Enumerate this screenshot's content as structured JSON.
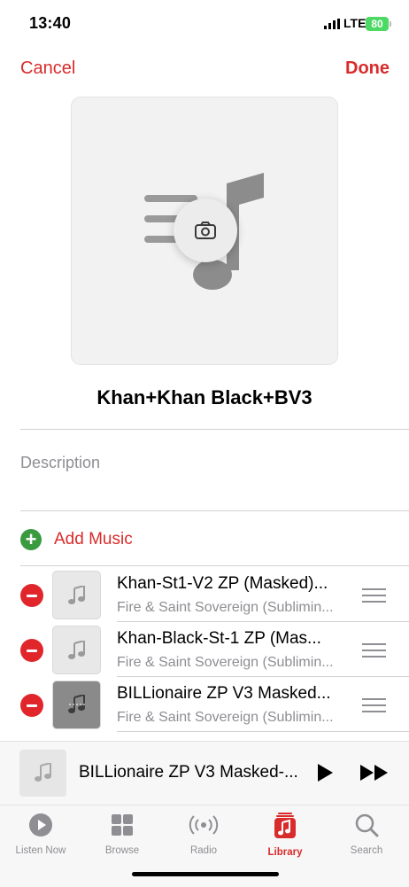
{
  "status_bar": {
    "time": "13:40",
    "network": "LTE",
    "battery": "80"
  },
  "nav": {
    "cancel_label": "Cancel",
    "done_label": "Done"
  },
  "playlist": {
    "title": "Khan+Khan Black+BV3",
    "description_placeholder": "Description"
  },
  "add_music_label": "Add Music",
  "tracks": [
    {
      "title": "Khan-St1-V2 ZP (Masked)...",
      "artist": "Fire & Saint Sovereign (Sublimin..."
    },
    {
      "title": "Khan-Black-St-1 ZP (Mas...",
      "artist": "Fire & Saint Sovereign (Sublimin..."
    },
    {
      "title": "BILLionaire ZP V3 Masked...",
      "artist": "Fire & Saint Sovereign (Sublimin..."
    }
  ],
  "mini_player": {
    "title": "BILLionaire ZP V3 Masked-..."
  },
  "tabs": [
    {
      "label": "Listen Now",
      "icon": "play-circle-icon"
    },
    {
      "label": "Browse",
      "icon": "grid-icon"
    },
    {
      "label": "Radio",
      "icon": "radio-waves-icon"
    },
    {
      "label": "Library",
      "icon": "music-library-icon"
    },
    {
      "label": "Search",
      "icon": "magnifier-icon"
    }
  ],
  "colors": {
    "accent": "#d92b2b",
    "add_green": "#3a9a3f",
    "remove_red": "#e0262b",
    "battery": "#4cd964"
  }
}
